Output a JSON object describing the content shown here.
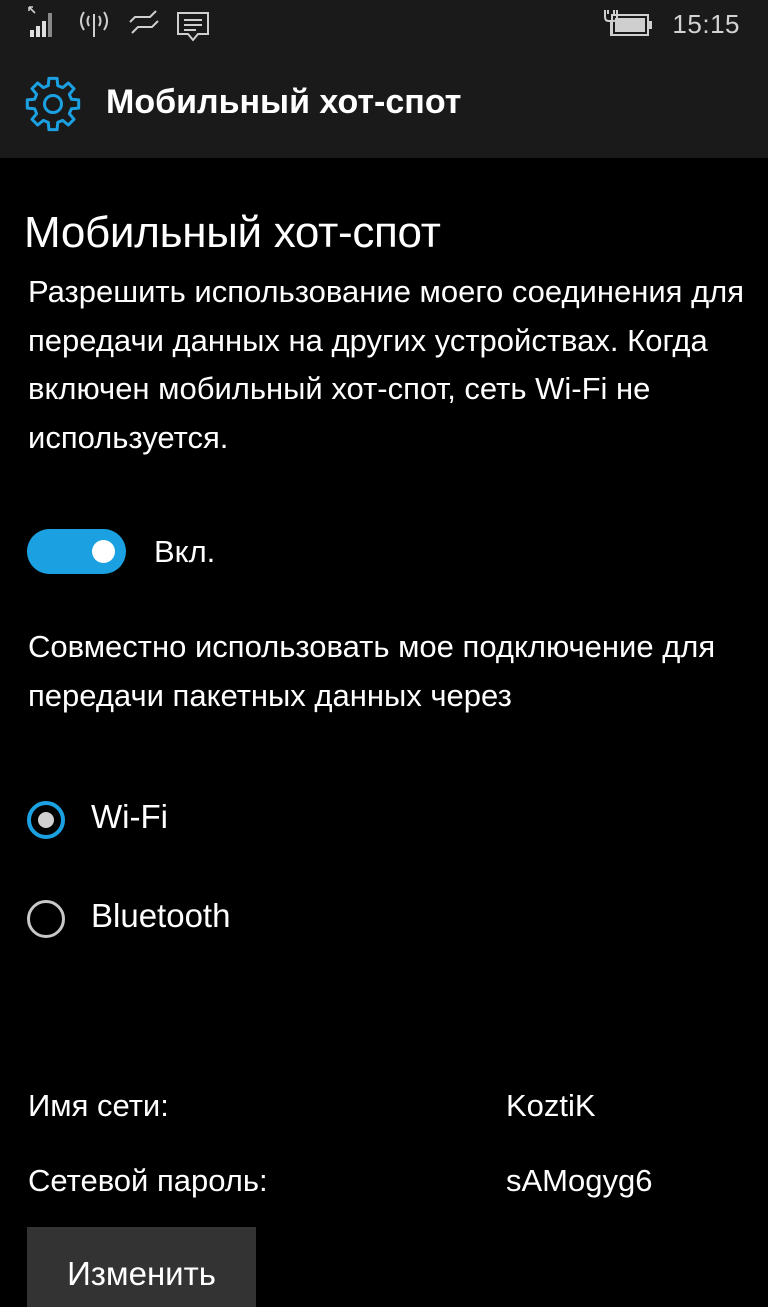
{
  "status_bar": {
    "icons": [
      "signal-strength-icon",
      "hotspot-broadcast-icon",
      "data-connection-icon",
      "notification-center-icon",
      "battery-charging-icon"
    ],
    "time": "15:15"
  },
  "header": {
    "icon": "gear-icon",
    "title": "Мобильный хот-спот"
  },
  "main": {
    "page_title": "Мобильный хот-спот",
    "description": "Разрешить использование моего соединения для передачи данных на других устройствах. Когда включен мобильный хот-спот, сеть Wi-Fi не используется.",
    "toggle": {
      "state": "on",
      "label": "Вкл."
    },
    "share_label": "Совместно использовать мое подключение для передачи пакетных данных через",
    "share_options": [
      {
        "label": "Wi-Fi",
        "selected": true
      },
      {
        "label": "Bluetooth",
        "selected": false
      }
    ],
    "network_info": [
      {
        "label": "Имя сети:",
        "value": "KoztiK"
      },
      {
        "label": "Сетевой пароль:",
        "value": "sAMogyg6"
      }
    ],
    "edit_button": "Изменить"
  },
  "colors": {
    "accent": "#1ba1e2",
    "background": "#000000",
    "header_background": "#1a1a1a",
    "button_background": "#333333"
  }
}
